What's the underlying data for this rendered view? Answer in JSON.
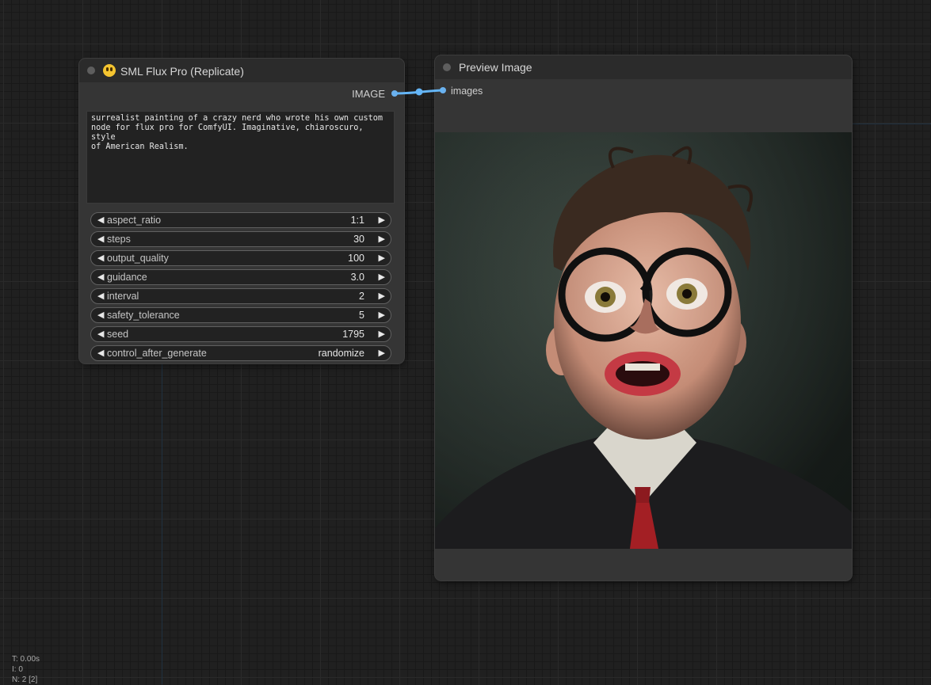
{
  "nodes": {
    "flux": {
      "title": "SML Flux Pro (Replicate)",
      "emoji_icon": "grinning-face",
      "output_label": "IMAGE",
      "prompt": "surrealist painting of a crazy nerd who wrote his own custom\nnode for flux pro for ComfyUI. Imaginative, chiaroscuro, style\nof American Realism.",
      "widgets": [
        {
          "label": "aspect_ratio",
          "value": "1:1"
        },
        {
          "label": "steps",
          "value": "30"
        },
        {
          "label": "output_quality",
          "value": "100"
        },
        {
          "label": "guidance",
          "value": "3.0"
        },
        {
          "label": "interval",
          "value": "2"
        },
        {
          "label": "safety_tolerance",
          "value": "5"
        },
        {
          "label": "seed",
          "value": "1795"
        },
        {
          "label": "control_after_generate",
          "value": "randomize"
        }
      ]
    },
    "preview": {
      "title": "Preview Image",
      "input_label": "images"
    }
  },
  "stats": {
    "time": "T: 0.00s",
    "iterations": "I: 0",
    "nodes": "N: 2 [2]"
  },
  "colors": {
    "canvas_bg": "#202020",
    "node_bg": "#353535",
    "node_header": "#2b2b2b",
    "slot_image": "#6bb1ee",
    "link": "#64b5f6"
  }
}
